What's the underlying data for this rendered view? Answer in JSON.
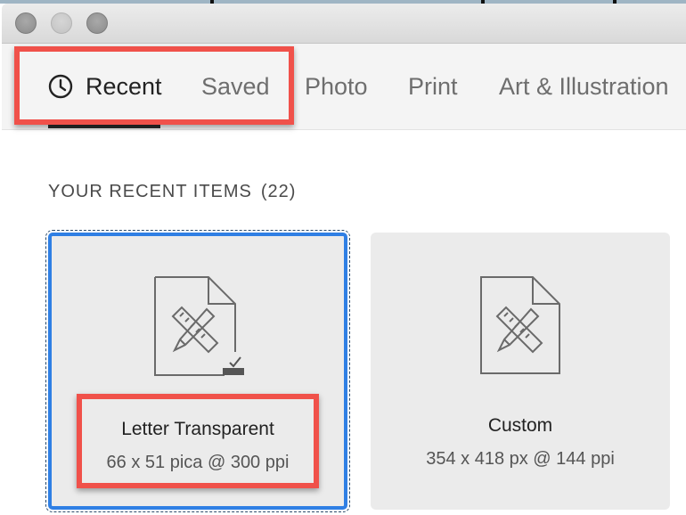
{
  "tabs": [
    {
      "label": "Recent",
      "icon": "clock-icon",
      "active": true
    },
    {
      "label": "Saved"
    },
    {
      "label": "Photo"
    },
    {
      "label": "Print"
    },
    {
      "label": "Art & Illustration"
    }
  ],
  "section": {
    "title": "YOUR RECENT ITEMS",
    "count": "(22)"
  },
  "items": [
    {
      "name": "Letter Transparent",
      "size": "66 x 51 pica @ 300 ppi",
      "icon": "artboard-document-icon",
      "selected": true
    },
    {
      "name": "Custom",
      "size": "354 x 418 px @ 144 ppi",
      "icon": "artboard-document-icon",
      "selected": false
    }
  ],
  "colors": {
    "accent": "#2f7fe4",
    "highlight": "#f0514a",
    "card_bg": "#ebebeb"
  }
}
